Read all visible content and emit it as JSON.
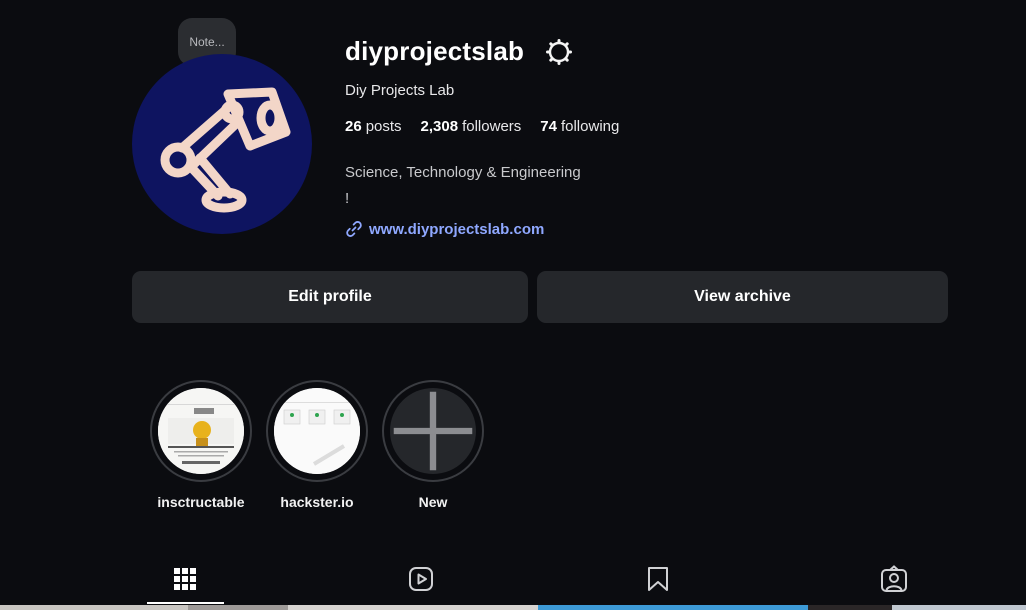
{
  "profile": {
    "note_placeholder": "Note...",
    "username": "diyprojectslab",
    "full_name": "Diy Projects Lab",
    "stats": {
      "posts_count": "26",
      "posts_label": "posts",
      "followers_count": "2,308",
      "followers_label": "followers",
      "following_count": "74",
      "following_label": "following"
    },
    "bio_line1": "Science, Technology & Engineering",
    "bio_line2": "!",
    "website": "www.diyprojectslab.com"
  },
  "buttons": {
    "edit_profile": "Edit profile",
    "view_archive": "View archive"
  },
  "highlights": [
    {
      "label": "insctructable"
    },
    {
      "label": "hackster.io"
    },
    {
      "label": "New"
    }
  ],
  "tabs": [
    "posts-grid",
    "reels",
    "saved",
    "tagged"
  ],
  "colors": {
    "background": "#0b0c10",
    "button_bg": "#25272b",
    "link": "#8fa8ff",
    "avatar_bg": "#0e1460"
  }
}
